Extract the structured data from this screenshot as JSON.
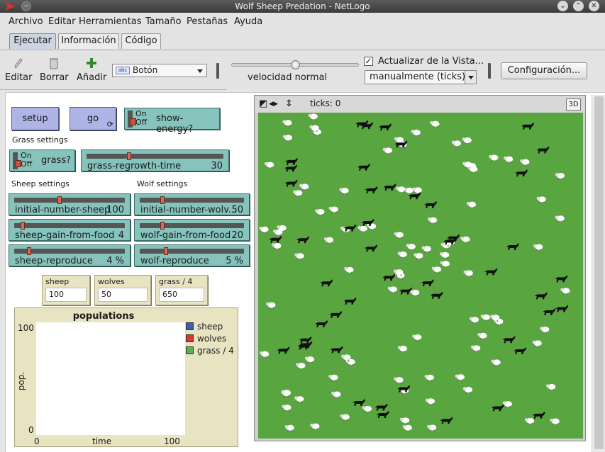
{
  "window": {
    "title": "Wolf Sheep Predation - NetLogo"
  },
  "menu": [
    "Archivo",
    "Editar",
    "Herramientas",
    "Tamaño",
    "Pestañas",
    "Ayuda"
  ],
  "tabs": [
    "Ejecutar",
    "Información",
    "Código"
  ],
  "toolbar": {
    "edit": "Editar",
    "delete": "Borrar",
    "add": "Añadir",
    "widget_type": "Botón",
    "widget_type_icon": "abc",
    "speed_label": "velocidad normal",
    "speed_fraction": 0.5,
    "view_updates_label": "Actualizar de la Vista...",
    "view_updates_checked": true,
    "update_mode": "manualmente (ticks)",
    "settings": "Configuración..."
  },
  "interface": {
    "setup": "setup",
    "go": "go",
    "switch_on": "On",
    "switch_off": "Off",
    "show_energy": "show-energy?",
    "grass_settings": "Grass settings",
    "grass_switch": "grass?",
    "sheep_settings": "Sheep settings",
    "wolf_settings": "Wolf settings",
    "sliders": {
      "grass_regrowth": {
        "name": "grass-regrowth-time",
        "value": "30",
        "fraction": 0.3
      },
      "initial_sheep": {
        "name": "initial-number-sheep",
        "value": "100",
        "fraction": 0.4
      },
      "initial_wolves": {
        "name": "initial-number-wolv...",
        "value": "50",
        "fraction": 0.2
      },
      "sheep_gain": {
        "name": "sheep-gain-from-food",
        "value": "4",
        "fraction": 0.06
      },
      "wolf_gain": {
        "name": "wolf-gain-from-food",
        "value": "20",
        "fraction": 0.2
      },
      "sheep_reproduce": {
        "name": "sheep-reproduce",
        "value": "4 %",
        "fraction": 0.12
      },
      "wolf_reproduce": {
        "name": "wolf-reproduce",
        "value": "5 %",
        "fraction": 0.24
      }
    },
    "monitors": {
      "sheep": {
        "label": "sheep",
        "value": "100"
      },
      "wolves": {
        "label": "wolves",
        "value": "50"
      },
      "grass": {
        "label": "grass / 4",
        "value": "650"
      }
    },
    "plot": {
      "title": "populations",
      "y_max": "100",
      "y_min": "0",
      "x_min": "0",
      "x_max": "100",
      "xlabel": "time",
      "ylabel": "pop.",
      "legend": [
        {
          "name": "sheep",
          "color": "#3a5fb0"
        },
        {
          "name": "wolves",
          "color": "#d63b2f"
        },
        {
          "name": "grass / 4",
          "color": "#59b24a"
        }
      ]
    }
  },
  "view": {
    "ticks_label": "ticks: 0",
    "btn_3d": "3D",
    "patch_color": "#59a540",
    "sheep_color": "#ffffff",
    "wolf_color": "#111111",
    "sheep_count": 100,
    "wolf_count": 50
  }
}
